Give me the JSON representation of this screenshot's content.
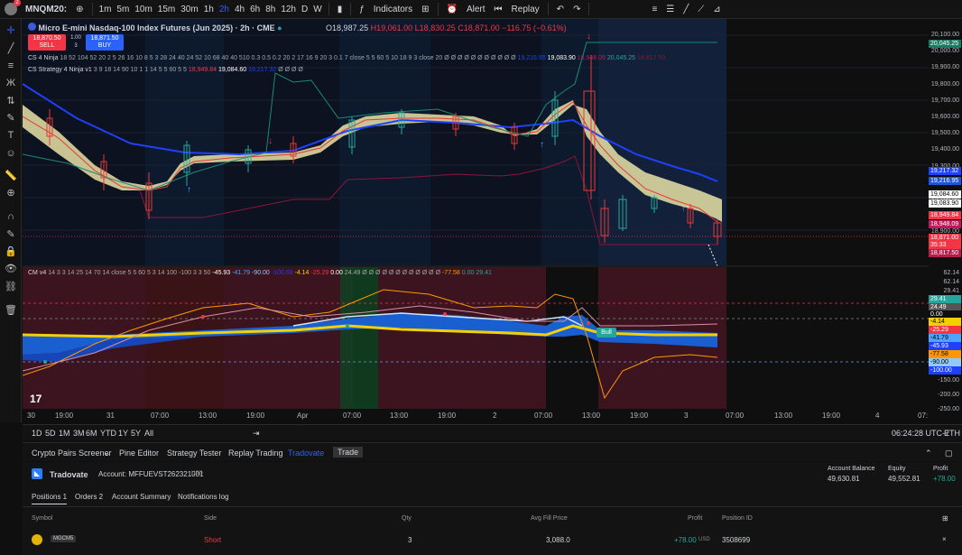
{
  "toolbar": {
    "symbol": "MNQM20:",
    "intervals": [
      "1m",
      "5m",
      "10m",
      "15m",
      "30m",
      "1h",
      "2h",
      "4h",
      "6h",
      "8h",
      "12h",
      "D",
      "W"
    ],
    "active_interval": "2h",
    "indicators": "Indicators",
    "alert": "Alert",
    "replay": "Replay"
  },
  "header": {
    "title": "Micro E-mini Nasdaq-100 Index Futures (Jun 2025) · 2h · CME",
    "o": "O18,987.25",
    "h": "H19,061.00",
    "l": "L18,830.25",
    "c": "C18,871.00",
    "chg": "−116.75 (−0.61%)",
    "sell_price": "18,870.50",
    "sell": "SELL",
    "spread": "1.00",
    "qty": "3",
    "buy_price": "18,871.50",
    "buy": "BUY"
  },
  "legends": {
    "l1_name": "CS 4 Ninja",
    "l1_params": "18 52 104 52 20 2 5 26 16 10 8 5 3 28 24 40 24 52 10 68 40 40 510 0.3 0.5 0.2 20 2 17 16 9 20 3 0.1 7 close 5 5 60 5 10 18 9 3 close 20 Ø Ø Ø Ø Ø Ø Ø Ø Ø Ø Ø",
    "l1_v1": "19,216.95",
    "l1_v2": "19,083.90",
    "l1_v3": "18,948.09",
    "l1_v4": "20,045.25",
    "l1_v5": "18,817.50",
    "l2_name": "CS Strategy 4 Ninja v1",
    "l2_params": "3 9 18 14 90 10 1 1 14 5 5 60 5 5",
    "l2_v1": "18,949.84",
    "l2_v2": "19,084.60",
    "l2_v3": "19,217.32",
    "l2_tail": "Ø Ø Ø Ø",
    "l3_name": "CM v4",
    "l3_params": "14 3 3 14 25 14 70 14 close 5 5 60 5 3 14 100 -100 3 3 50",
    "l3_v1": "-45.93",
    "l3_v2": "-41.79",
    "l3_v3": "-90.00",
    "l3_v4": "-100.00",
    "l3_v5": "-4.14",
    "l3_v6": "-25.29",
    "l3_v7": "0.00",
    "l3_v8": "24.49",
    "l3_tail": "Ø Ø Ø Ø Ø Ø Ø Ø Ø Ø Ø Ø",
    "l3_v9": "-77.58",
    "l3_v10": "0.00",
    "l3_v11": "29.41"
  },
  "price_axis": {
    "ticks": [
      "20,100.00",
      "20,000.00",
      "19,900.00",
      "19,800.00",
      "19,700.00",
      "19,600.00",
      "19,500.00",
      "19,400.00",
      "19,300.00",
      "19,200.00",
      "19,100.00",
      "19,000.00",
      "18,900.00"
    ],
    "tags": [
      {
        "v": "20,045.25",
        "c": "#1b7a64"
      },
      {
        "v": "19,217.32",
        "c": "#1e40ff"
      },
      {
        "v": "19,216.95",
        "c": "#1d55d6"
      },
      {
        "v": "19,084.60",
        "c": "#ffffff"
      },
      {
        "v": "19,083.90",
        "c": "#ffffff"
      },
      {
        "v": "18,949.84",
        "c": "#f23645"
      },
      {
        "v": "18,948.09",
        "c": "#c2185b"
      },
      {
        "v": "18,871.00",
        "c": "#f23645"
      },
      {
        "v": "35:33",
        "c": "#f23645"
      },
      {
        "v": "18,817.50",
        "c": "#b71c4a"
      }
    ]
  },
  "osc_axis": {
    "ticks": [
      "62.14",
      "62.14",
      "29.41",
      "24.49",
      "0.00",
      "-4.14",
      "-25.29",
      "-41.79",
      "-45.93",
      "-77.58",
      "-90.00",
      "-100.00",
      "-150.00",
      "-200.00",
      "-250.00"
    ],
    "tags": [
      {
        "v": "62.14",
        "c": "#0f0f0f",
        "fg": "#fff"
      },
      {
        "v": "62.14",
        "c": "#0f0f0f",
        "fg": "#fff"
      },
      {
        "v": "29.41",
        "c": "#0f0f0f",
        "fg": "#fff"
      },
      {
        "v": "29.41",
        "c": "#26a69a",
        "fg": "#fff"
      },
      {
        "v": "24.49",
        "c": "#555",
        "fg": "#fff"
      },
      {
        "v": "0.00",
        "c": "#0f0f0f",
        "fg": "#fff"
      },
      {
        "v": "-4.14",
        "c": "#f5d000",
        "fg": "#000"
      },
      {
        "v": "-25.29",
        "c": "#f23645",
        "fg": "#fff"
      },
      {
        "v": "-41.79",
        "c": "#4fa3ff",
        "fg": "#000"
      },
      {
        "v": "-45.93",
        "c": "#1e40ff",
        "fg": "#fff"
      },
      {
        "v": "-77.58",
        "c": "#ff9800",
        "fg": "#000"
      },
      {
        "v": "-90.00",
        "c": "#90caf9",
        "fg": "#000"
      },
      {
        "v": "-100.00",
        "c": "#1e40ff",
        "fg": "#fff"
      }
    ]
  },
  "bull_label": "Bull",
  "time_axis": [
    "30",
    "19:00",
    "31",
    "07:00",
    "13:00",
    "19:00",
    "Apr",
    "07:00",
    "13:00",
    "19:00",
    "2",
    "07:00",
    "13:00",
    "19:00",
    "3",
    "07:00",
    "13:00",
    "19:00",
    "4",
    "07:"
  ],
  "ranges": [
    "1D",
    "5D",
    "1M",
    "3M",
    "6M",
    "YTD",
    "1Y",
    "5Y",
    "All"
  ],
  "clock": "06:24:28 UTC-7",
  "session": "ETH",
  "tabs": [
    "Crypto Pairs Screener",
    "Pine Editor",
    "Strategy Tester",
    "Replay Trading",
    "Tradovate",
    "Trade"
  ],
  "broker": {
    "name": "Tradovate",
    "account": "Account: MFFUEVST262321001",
    "currency": "USD",
    "bal_label": "Account Balance",
    "bal": "49,630.81",
    "eq_label": "Equity",
    "eq": "49,552.81",
    "pr_label": "Profit",
    "pr": "+78.00"
  },
  "subtabs": [
    "Positions 1",
    "Orders 2",
    "Account Summary",
    "Notifications log"
  ],
  "columns": [
    "Symbol",
    "Side",
    "Qty",
    "Avg Fill Price",
    "Profit",
    "Position ID"
  ],
  "row": {
    "symbol": "MGCM5",
    "side": "Short",
    "qty": "3",
    "avg": "3,088.0",
    "profit": "+78.00",
    "profit_cur": "USD",
    "id": "3508699"
  }
}
